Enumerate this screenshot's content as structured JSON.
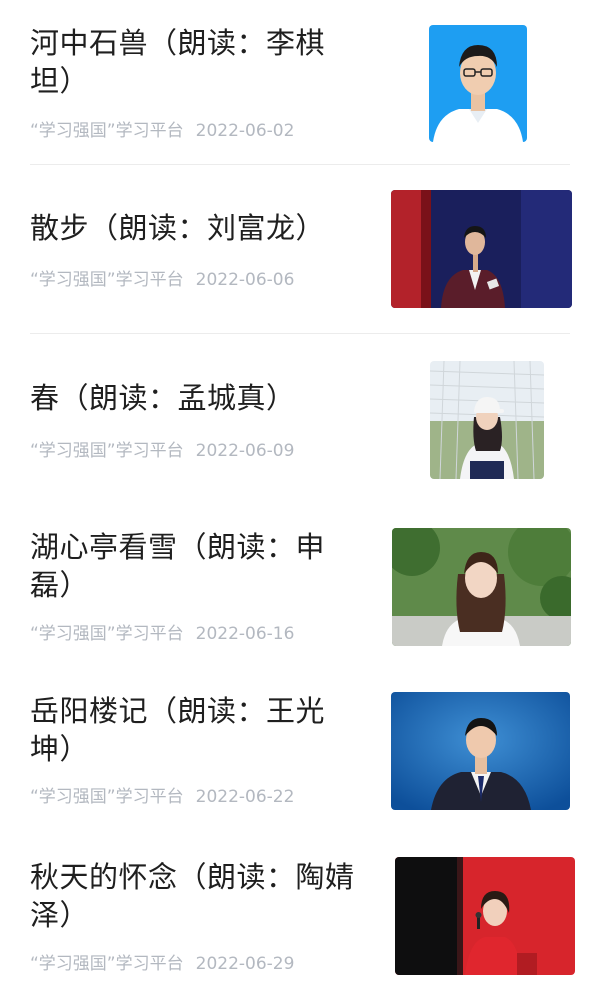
{
  "articles": [
    {
      "title": "河中石兽（朗读：李棋坦）",
      "source": "“学习强国”学习平台",
      "date": "2022-06-02",
      "thumbnail": "portrait-young-man-glasses-blue-backdrop"
    },
    {
      "title": "散步（朗读：刘富龙）",
      "source": "“学习强国”学习平台",
      "date": "2022-06-06",
      "thumbnail": "young-man-suit-on-stage-holding-card"
    },
    {
      "title": "春（朗读：孟城真）",
      "source": "“学习强国”学习平台",
      "date": "2022-06-09",
      "thumbnail": "girl-in-cap-by-soccer-goal-net"
    },
    {
      "title": "湖心亭看雪（朗读：申磊）",
      "source": "“学习强国”学习平台",
      "date": "2022-06-16",
      "thumbnail": "girl-long-hair-among-trees"
    },
    {
      "title": "岳阳楼记（朗读：王光坤）",
      "source": "“学习强国”学习平台",
      "date": "2022-06-22",
      "thumbnail": "portrait-young-man-suit-blue-backdrop"
    },
    {
      "title": "秋天的怀念（朗读：陶婧泽）",
      "source": "“学习强国”学习平台",
      "date": "2022-06-29",
      "thumbnail": "woman-red-suit-with-microphone-on-stage"
    }
  ],
  "colors": {
    "title": "#1f1f1f",
    "meta": "#b3b8c0",
    "divider": "#ececec"
  }
}
